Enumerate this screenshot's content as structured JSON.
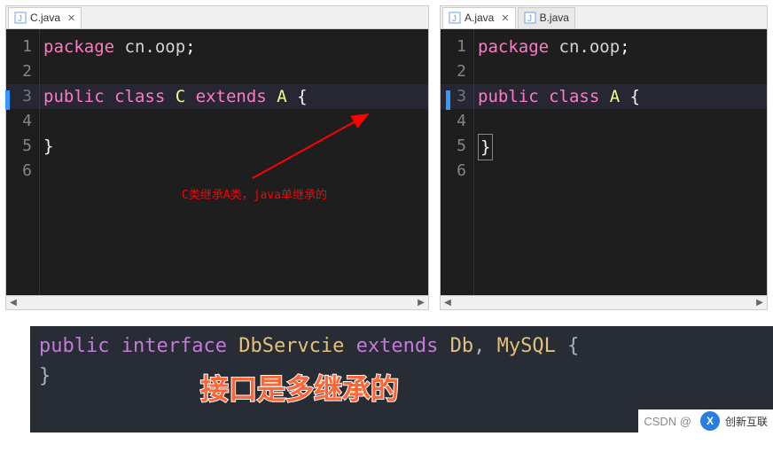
{
  "left_editor": {
    "tab_name": "C.java",
    "annotation": "C类继承A类，java单继承的",
    "code": {
      "l1_kw": "package",
      "l1_pkg": " cn.oop",
      "l1_sc": ";",
      "l3_kw1": "public",
      "l3_kw2": "class",
      "l3_cls": "C",
      "l3_kw3": "extends",
      "l3_sup": "A",
      "l3_brace": "{",
      "l5_brace": "}"
    }
  },
  "right_editor": {
    "tab1_name": "A.java",
    "tab2_name": "B.java",
    "code": {
      "l1_kw": "package",
      "l1_pkg": " cn.oop",
      "l1_sc": ";",
      "l3_kw1": "public",
      "l3_kw2": "class",
      "l3_cls": "A",
      "l3_brace": "{",
      "l5_brace": "}"
    }
  },
  "bottom": {
    "code": {
      "kw1": "public",
      "kw2": "interface",
      "cls": "DbServcie",
      "kw3": "extends",
      "sup1": "Db",
      "comma": ",",
      "sup2": "MySQL",
      "brace_o": "{",
      "brace_c": "}"
    },
    "big_label": "接口是多继承的",
    "csdn_prefix": "CSDN @",
    "wm_text": "创新互联"
  },
  "line_numbers": [
    "1",
    "2",
    "3",
    "4",
    "5",
    "6"
  ]
}
